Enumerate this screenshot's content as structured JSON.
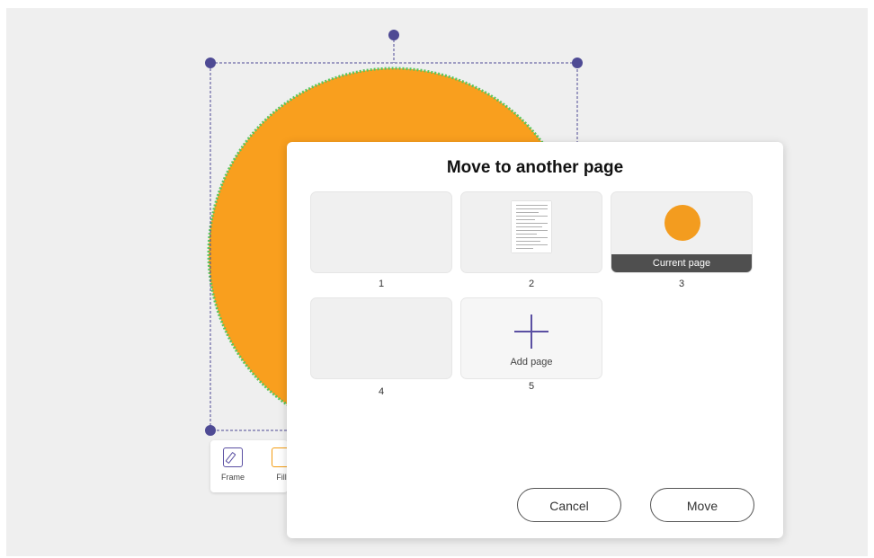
{
  "toolbar": {
    "frame_label": "Frame",
    "fill_label": "Fill"
  },
  "dialog": {
    "title": "Move to another page",
    "pages": [
      {
        "number": "1"
      },
      {
        "number": "2"
      },
      {
        "number": "3",
        "badge": "Current page"
      },
      {
        "number": "4"
      },
      {
        "number": "5",
        "label": "Add page"
      }
    ],
    "cancel_label": "Cancel",
    "move_label": "Move"
  },
  "colors": {
    "shape_fill": "#f99f1e",
    "shape_outline": "#5cc65c",
    "selection": "#4e4a94",
    "accent": "#5a4fa2"
  }
}
